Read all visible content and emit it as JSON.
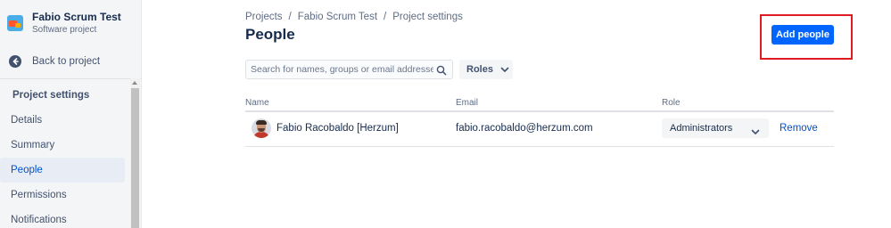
{
  "sidebar": {
    "project_name": "Fabio Scrum Test",
    "project_type": "Software project",
    "back_label": "Back to project",
    "section_title": "Project settings",
    "items": [
      {
        "label": "Details",
        "active": false
      },
      {
        "label": "Summary",
        "active": false
      },
      {
        "label": "People",
        "active": true
      },
      {
        "label": "Permissions",
        "active": false
      },
      {
        "label": "Notifications",
        "active": false
      }
    ]
  },
  "breadcrumb": [
    "Projects",
    "Fabio Scrum Test",
    "Project settings"
  ],
  "breadcrumb_separator": "/",
  "page": {
    "title": "People",
    "add_button_label": "Add people"
  },
  "filters": {
    "search_placeholder": "Search for names, groups or email addresses",
    "search_value": "",
    "roles_label": "Roles"
  },
  "table": {
    "headers": [
      "Name",
      "Email",
      "Role"
    ],
    "rows": [
      {
        "name": "Fabio Racobaldo [Herzum]",
        "email": "fabio.racobaldo@herzum.com",
        "role": "Administrators",
        "action": "Remove"
      }
    ]
  },
  "icons": {
    "back": "arrow-left-circle-icon",
    "search": "search-icon",
    "roles_dropdown": "chevron-down-icon",
    "role_dropdown": "chevron-down-icon"
  },
  "colors": {
    "primary_button": "#0065ff",
    "link": "#0052cc",
    "highlight_box": "#e01b24",
    "active_nav_bg": "#e8ecf5"
  }
}
